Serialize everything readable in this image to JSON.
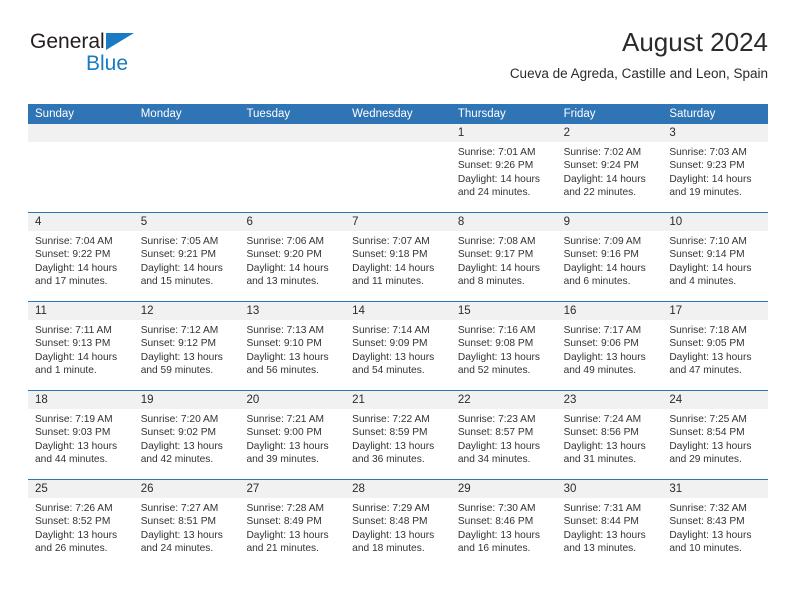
{
  "brand": {
    "word1": "General",
    "word2": "Blue",
    "triangle_color": "#1a7ac4",
    "word2_color": "#1a7ac4"
  },
  "header": {
    "title": "August 2024",
    "subtitle": "Cueva de Agreda, Castille and Leon, Spain"
  },
  "colors": {
    "header_blue": "#2f74b5",
    "daynum_band": "#f1f1f1",
    "text": "#333333"
  },
  "calendar": {
    "weekday_headers": [
      "Sunday",
      "Monday",
      "Tuesday",
      "Wednesday",
      "Thursday",
      "Friday",
      "Saturday"
    ],
    "weeks": [
      [
        {
          "day": "",
          "lines": []
        },
        {
          "day": "",
          "lines": []
        },
        {
          "day": "",
          "lines": []
        },
        {
          "day": "",
          "lines": []
        },
        {
          "day": "1",
          "lines": [
            "Sunrise: 7:01 AM",
            "Sunset: 9:26 PM",
            "Daylight: 14 hours",
            "and 24 minutes."
          ]
        },
        {
          "day": "2",
          "lines": [
            "Sunrise: 7:02 AM",
            "Sunset: 9:24 PM",
            "Daylight: 14 hours",
            "and 22 minutes."
          ]
        },
        {
          "day": "3",
          "lines": [
            "Sunrise: 7:03 AM",
            "Sunset: 9:23 PM",
            "Daylight: 14 hours",
            "and 19 minutes."
          ]
        }
      ],
      [
        {
          "day": "4",
          "lines": [
            "Sunrise: 7:04 AM",
            "Sunset: 9:22 PM",
            "Daylight: 14 hours",
            "and 17 minutes."
          ]
        },
        {
          "day": "5",
          "lines": [
            "Sunrise: 7:05 AM",
            "Sunset: 9:21 PM",
            "Daylight: 14 hours",
            "and 15 minutes."
          ]
        },
        {
          "day": "6",
          "lines": [
            "Sunrise: 7:06 AM",
            "Sunset: 9:20 PM",
            "Daylight: 14 hours",
            "and 13 minutes."
          ]
        },
        {
          "day": "7",
          "lines": [
            "Sunrise: 7:07 AM",
            "Sunset: 9:18 PM",
            "Daylight: 14 hours",
            "and 11 minutes."
          ]
        },
        {
          "day": "8",
          "lines": [
            "Sunrise: 7:08 AM",
            "Sunset: 9:17 PM",
            "Daylight: 14 hours",
            "and 8 minutes."
          ]
        },
        {
          "day": "9",
          "lines": [
            "Sunrise: 7:09 AM",
            "Sunset: 9:16 PM",
            "Daylight: 14 hours",
            "and 6 minutes."
          ]
        },
        {
          "day": "10",
          "lines": [
            "Sunrise: 7:10 AM",
            "Sunset: 9:14 PM",
            "Daylight: 14 hours",
            "and 4 minutes."
          ]
        }
      ],
      [
        {
          "day": "11",
          "lines": [
            "Sunrise: 7:11 AM",
            "Sunset: 9:13 PM",
            "Daylight: 14 hours",
            "and 1 minute."
          ]
        },
        {
          "day": "12",
          "lines": [
            "Sunrise: 7:12 AM",
            "Sunset: 9:12 PM",
            "Daylight: 13 hours",
            "and 59 minutes."
          ]
        },
        {
          "day": "13",
          "lines": [
            "Sunrise: 7:13 AM",
            "Sunset: 9:10 PM",
            "Daylight: 13 hours",
            "and 56 minutes."
          ]
        },
        {
          "day": "14",
          "lines": [
            "Sunrise: 7:14 AM",
            "Sunset: 9:09 PM",
            "Daylight: 13 hours",
            "and 54 minutes."
          ]
        },
        {
          "day": "15",
          "lines": [
            "Sunrise: 7:16 AM",
            "Sunset: 9:08 PM",
            "Daylight: 13 hours",
            "and 52 minutes."
          ]
        },
        {
          "day": "16",
          "lines": [
            "Sunrise: 7:17 AM",
            "Sunset: 9:06 PM",
            "Daylight: 13 hours",
            "and 49 minutes."
          ]
        },
        {
          "day": "17",
          "lines": [
            "Sunrise: 7:18 AM",
            "Sunset: 9:05 PM",
            "Daylight: 13 hours",
            "and 47 minutes."
          ]
        }
      ],
      [
        {
          "day": "18",
          "lines": [
            "Sunrise: 7:19 AM",
            "Sunset: 9:03 PM",
            "Daylight: 13 hours",
            "and 44 minutes."
          ]
        },
        {
          "day": "19",
          "lines": [
            "Sunrise: 7:20 AM",
            "Sunset: 9:02 PM",
            "Daylight: 13 hours",
            "and 42 minutes."
          ]
        },
        {
          "day": "20",
          "lines": [
            "Sunrise: 7:21 AM",
            "Sunset: 9:00 PM",
            "Daylight: 13 hours",
            "and 39 minutes."
          ]
        },
        {
          "day": "21",
          "lines": [
            "Sunrise: 7:22 AM",
            "Sunset: 8:59 PM",
            "Daylight: 13 hours",
            "and 36 minutes."
          ]
        },
        {
          "day": "22",
          "lines": [
            "Sunrise: 7:23 AM",
            "Sunset: 8:57 PM",
            "Daylight: 13 hours",
            "and 34 minutes."
          ]
        },
        {
          "day": "23",
          "lines": [
            "Sunrise: 7:24 AM",
            "Sunset: 8:56 PM",
            "Daylight: 13 hours",
            "and 31 minutes."
          ]
        },
        {
          "day": "24",
          "lines": [
            "Sunrise: 7:25 AM",
            "Sunset: 8:54 PM",
            "Daylight: 13 hours",
            "and 29 minutes."
          ]
        }
      ],
      [
        {
          "day": "25",
          "lines": [
            "Sunrise: 7:26 AM",
            "Sunset: 8:52 PM",
            "Daylight: 13 hours",
            "and 26 minutes."
          ]
        },
        {
          "day": "26",
          "lines": [
            "Sunrise: 7:27 AM",
            "Sunset: 8:51 PM",
            "Daylight: 13 hours",
            "and 24 minutes."
          ]
        },
        {
          "day": "27",
          "lines": [
            "Sunrise: 7:28 AM",
            "Sunset: 8:49 PM",
            "Daylight: 13 hours",
            "and 21 minutes."
          ]
        },
        {
          "day": "28",
          "lines": [
            "Sunrise: 7:29 AM",
            "Sunset: 8:48 PM",
            "Daylight: 13 hours",
            "and 18 minutes."
          ]
        },
        {
          "day": "29",
          "lines": [
            "Sunrise: 7:30 AM",
            "Sunset: 8:46 PM",
            "Daylight: 13 hours",
            "and 16 minutes."
          ]
        },
        {
          "day": "30",
          "lines": [
            "Sunrise: 7:31 AM",
            "Sunset: 8:44 PM",
            "Daylight: 13 hours",
            "and 13 minutes."
          ]
        },
        {
          "day": "31",
          "lines": [
            "Sunrise: 7:32 AM",
            "Sunset: 8:43 PM",
            "Daylight: 13 hours",
            "and 10 minutes."
          ]
        }
      ]
    ]
  }
}
